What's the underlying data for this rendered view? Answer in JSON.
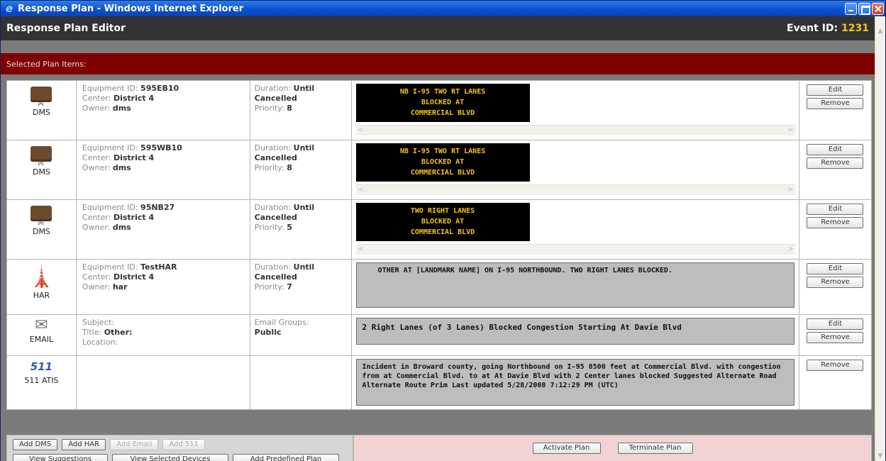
{
  "window": {
    "title": "Response Plan - Windows Internet Explorer"
  },
  "header": {
    "title": "Response Plan Editor",
    "event_label": "Event ID:",
    "event_id": "1231"
  },
  "section": {
    "label": "Selected Plan Items:"
  },
  "labels": {
    "equipment_id": "Equipment ID:",
    "center": "Center:",
    "owner": "Owner:",
    "duration": "Duration:",
    "priority": "Priority:",
    "subject": "Subject:",
    "title": "Title:",
    "location": "Location:",
    "email_groups": "Email Groups:",
    "edit": "Edit",
    "remove": "Remove"
  },
  "items": [
    {
      "type": "DMS",
      "icon": "dms-sign-icon",
      "equipment_id": "595EB10",
      "center": "District 4",
      "owner": "dms",
      "duration_a": "Until",
      "duration_b": "Cancelled",
      "priority": "8",
      "message": "NB I-95 TWO RT LANES\nBLOCKED AT\nCOMMERCIAL BLVD"
    },
    {
      "type": "DMS",
      "icon": "dms-sign-icon",
      "equipment_id": "595WB10",
      "center": "District 4",
      "owner": "dms",
      "duration_a": "Until",
      "duration_b": "Cancelled",
      "priority": "8",
      "message": "NB I-95 TWO RT LANES\nBLOCKED AT\nCOMMERCIAL BLVD"
    },
    {
      "type": "DMS",
      "icon": "dms-sign-icon",
      "equipment_id": "95NB27",
      "center": "District 4",
      "owner": "dms",
      "duration_a": "Until",
      "duration_b": "Cancelled",
      "priority": "5",
      "message": "TWO RIGHT LANES\nBLOCKED AT\nCOMMERCIAL BLVD"
    },
    {
      "type": "HAR",
      "icon": "radio-tower-icon",
      "equipment_id": "TestHAR",
      "center": "District 4",
      "owner": "har",
      "duration_a": "Until",
      "duration_b": "Cancelled",
      "priority": "7",
      "message": "OTHER AT [LANDMARK NAME] ON I-95 NORTHBOUND. TWO RIGHT LANES BLOCKED."
    },
    {
      "type": "EMAIL",
      "icon": "envelope-icon",
      "title_value": "Other:",
      "email_groups_value": "Public",
      "message": "2 Right Lanes (of 3 Lanes) Blocked Congestion Starting At Davie Blvd"
    },
    {
      "type": "511 ATIS",
      "icon": "511-logo-icon",
      "icon_text": "511",
      "message": "Incident in Broward county, going Northbound on I-95 8500 feet at Commercial Blvd. with congestion from at Commercial Blvd. to at At Davie Blvd with 2 Center lanes blocked Suggested Alternate Road Alternate Route Prim Last updated 5/28/2008 7:12:29 PM (UTC)"
    }
  ],
  "bottom": {
    "add_dms": "Add DMS",
    "add_har": "Add HAR",
    "add_email": "Add Email",
    "add_511": "Add 511",
    "view_suggestions": "View Suggestions",
    "view_selected": "View Selected Devices",
    "add_predefined": "Add Predefined Plan",
    "activate": "Activate Plan",
    "terminate": "Terminate Plan"
  }
}
